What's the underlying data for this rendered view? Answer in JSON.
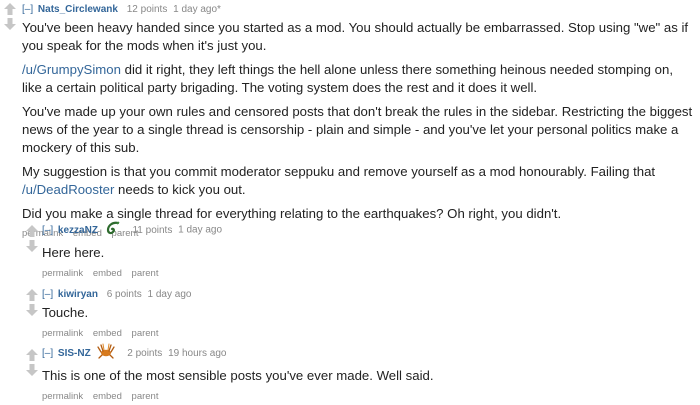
{
  "main_comment": {
    "expand": "[–]",
    "author": "Nats_Circlewank",
    "score": "12 points",
    "time": "1 day ago*",
    "paragraphs": {
      "p1": "You've been heavy handed since you started as a mod. You should actually be embarrassed. Stop using \"we\" as if you speak for the mods when it's just you.",
      "p2_link": "/u/GrumpySimon",
      "p2_rest": " did it right, they left things the hell alone unless there something heinous needed stomping on, like a certain political party brigading. The voting system does the rest and it does it well.",
      "p3": "You've made up your own rules and censored posts that don't break the rules in the sidebar. Restricting the biggest news of the year to a single thread is censorship - plain and simple - and you've let your personal politics make a mockery of this sub.",
      "p4_before": "My suggestion is that you commit moderator seppuku and remove yourself as a mod honourably. Failing that ",
      "p4_link": "/u/DeadRooster",
      "p4_after": " needs to kick you out.",
      "p5": "Did you make a single thread for everything relating to the earthquakes? Oh right, you didn't."
    },
    "buttons": [
      "permalink",
      "embed",
      "parent"
    ]
  },
  "replies": [
    {
      "expand": "[–]",
      "author": "kezzaNZ",
      "flair_icon": "fern-flair-icon",
      "score": "11 points",
      "time": "1 day ago",
      "text": "Here here.",
      "buttons": [
        "permalink",
        "embed",
        "parent"
      ]
    },
    {
      "expand": "[–]",
      "author": "kiwiryan",
      "score": "6 points",
      "time": "1 day ago",
      "text": "Touche.",
      "buttons": [
        "permalink",
        "embed",
        "parent"
      ]
    },
    {
      "expand": "[–]",
      "author": "SIS-NZ",
      "flair_icon": "weta-flair-icon",
      "score": "2 points",
      "time": "19 hours ago",
      "text": "This is one of the most sensible posts you've ever made. Well said.",
      "buttons": [
        "permalink",
        "embed",
        "parent"
      ]
    }
  ],
  "colors": {
    "link": "#336699",
    "meta": "#888888",
    "arrow": "#c6c6c6",
    "text": "#222222"
  }
}
